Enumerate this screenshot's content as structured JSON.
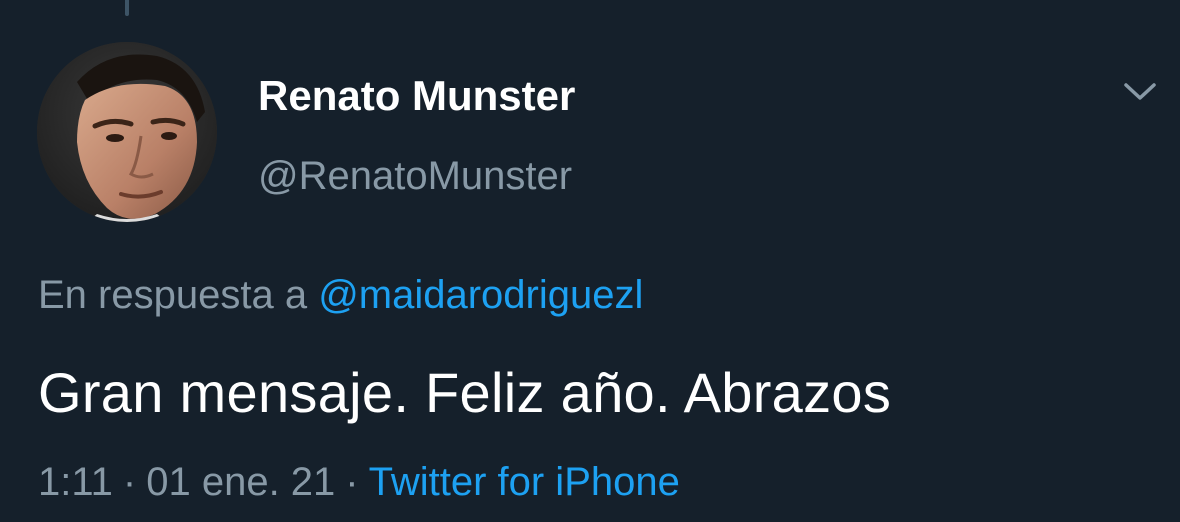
{
  "tweet": {
    "author": {
      "display_name": "Renato Munster",
      "handle": "@RenatoMunster"
    },
    "reply": {
      "prefix": "En respuesta a",
      "mention": "@maidarodriguezl"
    },
    "text": "Gran mensaje. Feliz año. Abrazos",
    "meta": {
      "time": "1:11",
      "separator": "·",
      "date": "01 ene. 21",
      "source": "Twitter for iPhone"
    },
    "menu_icon": "chevron-down-icon"
  },
  "colors": {
    "background": "#15202b",
    "primary_text": "#ffffff",
    "secondary_text": "#8899a6",
    "link": "#1da1f2",
    "thread_line": "#3d5466"
  }
}
